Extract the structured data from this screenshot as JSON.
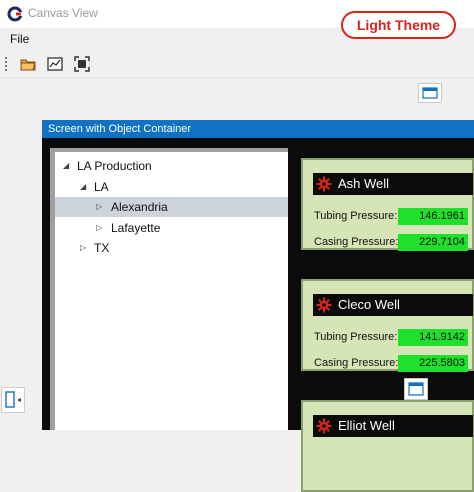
{
  "window": {
    "title": "Canvas View"
  },
  "theme_badge": "Light Theme",
  "menu": {
    "file": "File"
  },
  "toolbar": {
    "icons": [
      "open-folder-icon",
      "chart-icon",
      "fit-screen-icon"
    ]
  },
  "screen": {
    "title": "Screen with Object Container",
    "tree": [
      {
        "label": "LA Production",
        "expanded": true
      },
      {
        "label": "LA",
        "expanded": true
      },
      {
        "label": "Alexandria",
        "expanded": false,
        "selected": true
      },
      {
        "label": "Lafayette",
        "expanded": false
      },
      {
        "label": "TX",
        "expanded": false
      }
    ],
    "wells": [
      {
        "name": "Ash Well",
        "tubing_label": "Tubing Pressure:",
        "tubing_value": "146.1961",
        "casing_label": "Casing Pressure:",
        "casing_value": "229.7104"
      },
      {
        "name": "Cleco Well",
        "tubing_label": "Tubing Pressure:",
        "tubing_value": "141.9142",
        "casing_label": "Casing Pressure:",
        "casing_value": "225.5803"
      },
      {
        "name": "Elliot Well"
      }
    ]
  },
  "colors": {
    "accent": "#1072c3",
    "badge": "#d9241c",
    "value_bg": "#1fe12b",
    "card_bg": "#d5e5b5"
  }
}
